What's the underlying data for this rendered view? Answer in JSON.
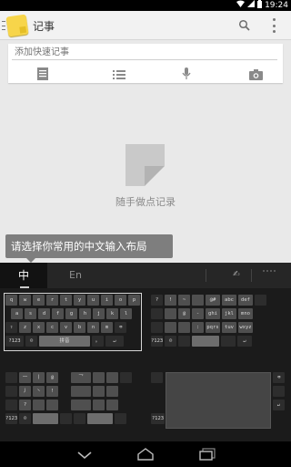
{
  "status_bar": {
    "time": "19:24",
    "icons": [
      "wifi-icon",
      "signal-icon",
      "battery-icon"
    ]
  },
  "action_bar": {
    "title": "记事",
    "icons": [
      "menu-icon",
      "app-note-icon",
      "search-icon",
      "overflow-icon"
    ]
  },
  "quick_note": {
    "placeholder": "添加快速记事",
    "tools": [
      "note-list-icon",
      "checklist-icon",
      "microphone-icon",
      "camera-icon"
    ]
  },
  "empty_state": {
    "text": "随手做点记录"
  },
  "tooltip": {
    "text": "请选择你常用的中文输入布局"
  },
  "language_bar": {
    "chinese_label": "中",
    "english_label": "En",
    "handwriting_label": "✍"
  },
  "layouts": {
    "qwerty": {
      "rows": [
        [
          "q",
          "w",
          "e",
          "r",
          "t",
          "y",
          "u",
          "i",
          "o",
          "p"
        ],
        [
          "a",
          "s",
          "d",
          "f",
          "g",
          "h",
          "j",
          "k",
          "l"
        ],
        [
          "⇧",
          "z",
          "x",
          "c",
          "v",
          "b",
          "n",
          "m",
          "⌫"
        ],
        [
          "?123",
          "☺",
          "拼音",
          "。",
          "↵"
        ]
      ]
    },
    "nine_key": {
      "rows": [
        [
          "?",
          "!",
          "~",
          "",
          "@#",
          "abc",
          "def",
          ""
        ],
        [
          "",
          "",
          "@",
          "-",
          "ghi",
          "jkl",
          "mno"
        ],
        [
          "",
          "",
          "",
          ":",
          "pqrs",
          "tuv",
          "wxyz"
        ],
        [
          "?123",
          "☺",
          "",
          "",
          "",
          "↵"
        ]
      ]
    },
    "stroke": {
      "rows": [
        [
          "一",
          "丨",
          "@"
        ],
        [
          "丿",
          "丶",
          "!",
          "乛"
        ],
        [
          "?",
          "",
          "",
          ""
        ],
        [
          "?123",
          "☺",
          "",
          ""
        ]
      ]
    },
    "handwriting": {
      "row_labels": [
        "⌫",
        "",
        "↵"
      ],
      "bottom_left": "?123"
    }
  },
  "nav_bar": {
    "icons": [
      "back-icon",
      "home-icon",
      "recents-icon"
    ]
  }
}
